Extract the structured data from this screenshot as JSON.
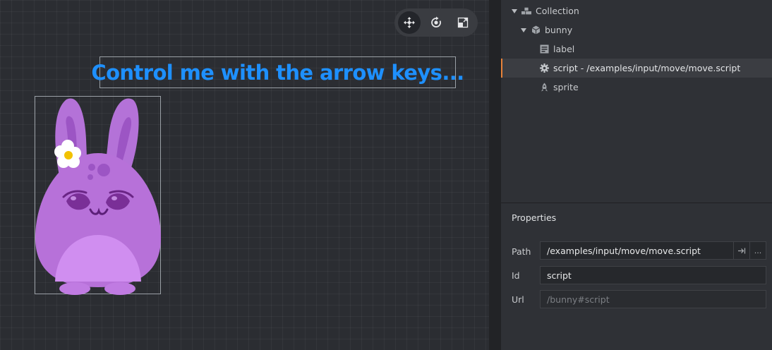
{
  "scene": {
    "label_text": "Control me with the arrow keys..."
  },
  "toolbar": {
    "tools": [
      {
        "name": "move-tool",
        "icon": "move-icon",
        "active": true
      },
      {
        "name": "rotate-tool",
        "icon": "rotate-icon",
        "active": false
      },
      {
        "name": "scale-tool",
        "icon": "scale-icon",
        "active": false
      }
    ]
  },
  "outline": {
    "items": [
      {
        "label": "Collection",
        "icon": "collection-icon",
        "expandable": true
      },
      {
        "label": "bunny",
        "icon": "game-object-icon",
        "expandable": true
      },
      {
        "label": "label",
        "icon": "label-icon",
        "expandable": false
      },
      {
        "label": "script - /examples/input/move/move.script",
        "icon": "gear-icon",
        "expandable": false,
        "selected": true
      },
      {
        "label": "sprite",
        "icon": "sprite-icon",
        "expandable": false
      }
    ]
  },
  "properties": {
    "title": "Properties",
    "path_label": "Path",
    "path_value": "/examples/input/move/move.script",
    "id_label": "Id",
    "id_value": "script",
    "url_label": "Url",
    "url_value": "/bunny#script",
    "more_label": "..."
  },
  "colors": {
    "label_text": "#1e90ff",
    "selection_accent": "#e8833a",
    "bunny_body": "#b771d9"
  }
}
